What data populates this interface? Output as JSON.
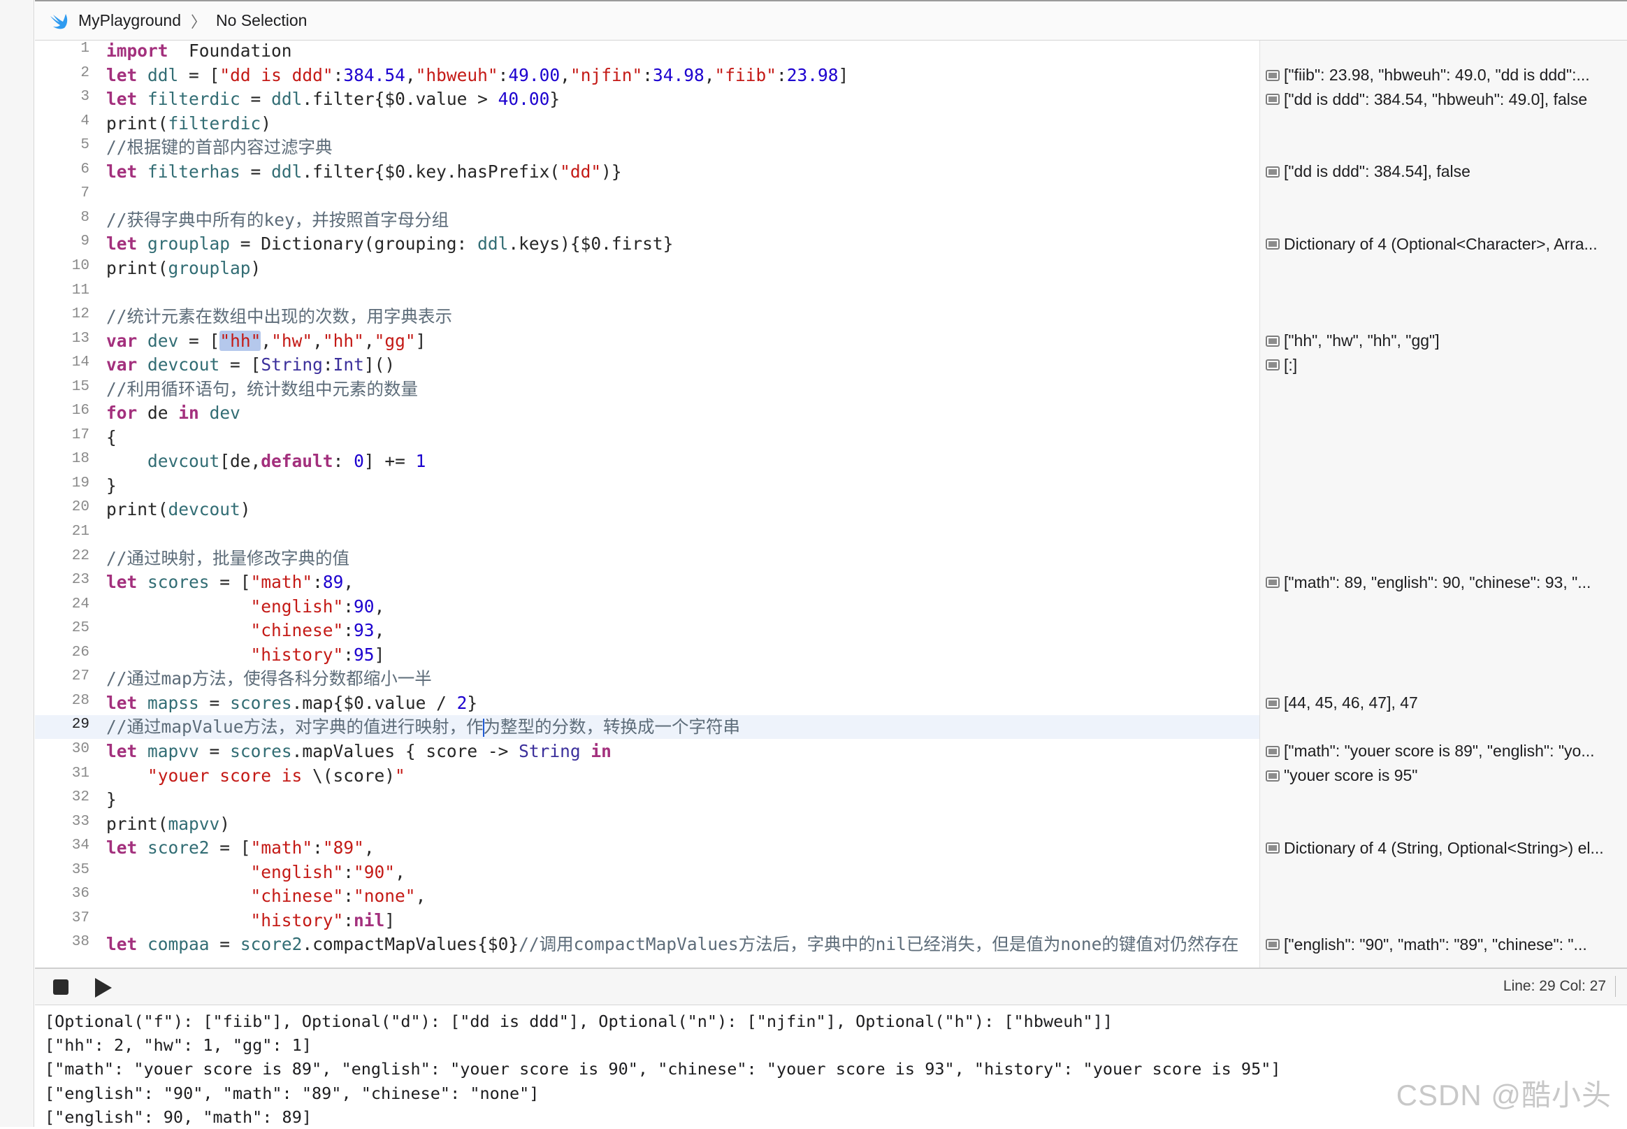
{
  "jumpbar": {
    "project": "MyPlayground",
    "selection": "No Selection"
  },
  "editor": {
    "current_line": 29,
    "lines": [
      {
        "n": "1",
        "tokens": [
          [
            "kw",
            "import"
          ],
          [
            "",
            "  Foundation"
          ]
        ]
      },
      {
        "n": "2",
        "tokens": [
          [
            "kw",
            "let"
          ],
          [
            "",
            " "
          ],
          [
            "id",
            "ddl"
          ],
          [
            "",
            " = ["
          ],
          [
            "str",
            "\"dd is ddd\""
          ],
          [
            "",
            ":"
          ],
          [
            "num",
            "384.54"
          ],
          [
            "",
            ","
          ],
          [
            "str",
            "\"hbweuh\""
          ],
          [
            "",
            ":"
          ],
          [
            "num",
            "49.00"
          ],
          [
            "",
            ","
          ],
          [
            "str",
            "\"njfin\""
          ],
          [
            "",
            ":"
          ],
          [
            "num",
            "34.98"
          ],
          [
            "",
            ","
          ],
          [
            "str",
            "\"fiib\""
          ],
          [
            "",
            ":"
          ],
          [
            "num",
            "23.98"
          ],
          [
            "",
            "]"
          ]
        ]
      },
      {
        "n": "3",
        "tokens": [
          [
            "kw",
            "let"
          ],
          [
            "",
            " "
          ],
          [
            "id",
            "filterdic"
          ],
          [
            "",
            " = "
          ],
          [
            "id",
            "ddl"
          ],
          [
            "",
            ".filter{$0.value > "
          ],
          [
            "num",
            "40.00"
          ],
          [
            "",
            "}"
          ]
        ]
      },
      {
        "n": "4",
        "tokens": [
          [
            "",
            "print("
          ],
          [
            "id",
            "filterdic"
          ],
          [
            "",
            ")"
          ]
        ]
      },
      {
        "n": "5",
        "tokens": [
          [
            "cm",
            "//根据键的首部内容过滤字典"
          ]
        ]
      },
      {
        "n": "6",
        "tokens": [
          [
            "kw",
            "let"
          ],
          [
            "",
            " "
          ],
          [
            "id",
            "filterhas"
          ],
          [
            "",
            " = "
          ],
          [
            "id",
            "ddl"
          ],
          [
            "",
            ".filter{$0.key.hasPrefix("
          ],
          [
            "str",
            "\"dd\""
          ],
          [
            "",
            ")}"
          ]
        ]
      },
      {
        "n": "7",
        "tokens": []
      },
      {
        "n": "8",
        "tokens": [
          [
            "cm",
            "//获得字典中所有的key，并按照首字母分组"
          ]
        ]
      },
      {
        "n": "9",
        "tokens": [
          [
            "kw",
            "let"
          ],
          [
            "",
            " "
          ],
          [
            "id",
            "grouplap"
          ],
          [
            "",
            " = Dictionary(grouping: "
          ],
          [
            "id",
            "ddl"
          ],
          [
            "",
            ".keys){$0.first}"
          ]
        ]
      },
      {
        "n": "10",
        "tokens": [
          [
            "",
            "print("
          ],
          [
            "id",
            "grouplap"
          ],
          [
            "",
            ")"
          ]
        ]
      },
      {
        "n": "11",
        "tokens": []
      },
      {
        "n": "12",
        "tokens": [
          [
            "cm",
            "//统计元素在数组中出现的次数，用字典表示"
          ]
        ]
      },
      {
        "n": "13",
        "tokens": [
          [
            "kw",
            "var"
          ],
          [
            "",
            " "
          ],
          [
            "id",
            "dev"
          ],
          [
            "",
            " = ["
          ],
          [
            "hlstr",
            "\"hh\""
          ],
          [
            "",
            ","
          ],
          [
            "str",
            "\"hw\""
          ],
          [
            "",
            ","
          ],
          [
            "str",
            "\"hh\""
          ],
          [
            "",
            ","
          ],
          [
            "str",
            "\"gg\""
          ],
          [
            "",
            "]"
          ]
        ]
      },
      {
        "n": "14",
        "tokens": [
          [
            "kw",
            "var"
          ],
          [
            "",
            " "
          ],
          [
            "id",
            "devcout"
          ],
          [
            "",
            " = ["
          ],
          [
            "ty",
            "String"
          ],
          [
            "",
            ":"
          ],
          [
            "ty",
            "Int"
          ],
          [
            "",
            "]()"
          ]
        ]
      },
      {
        "n": "15",
        "tokens": [
          [
            "cm",
            "//利用循环语句，统计数组中元素的数量"
          ]
        ]
      },
      {
        "n": "16",
        "tokens": [
          [
            "kw",
            "for"
          ],
          [
            "",
            " de "
          ],
          [
            "kw",
            "in"
          ],
          [
            "",
            " "
          ],
          [
            "id",
            "dev"
          ]
        ]
      },
      {
        "n": "17",
        "tokens": [
          [
            "",
            "{"
          ]
        ]
      },
      {
        "n": "18",
        "tokens": [
          [
            "",
            "    "
          ],
          [
            "id",
            "devcout"
          ],
          [
            "",
            "[de,"
          ],
          [
            "kw",
            "default"
          ],
          [
            "",
            ": "
          ],
          [
            "num",
            "0"
          ],
          [
            "",
            "] += "
          ],
          [
            "num",
            "1"
          ]
        ]
      },
      {
        "n": "19",
        "tokens": [
          [
            "",
            "}"
          ]
        ]
      },
      {
        "n": "20",
        "tokens": [
          [
            "",
            "print("
          ],
          [
            "id",
            "devcout"
          ],
          [
            "",
            ")"
          ]
        ]
      },
      {
        "n": "21",
        "tokens": []
      },
      {
        "n": "22",
        "tokens": [
          [
            "cm",
            "//通过映射，批量修改字典的值"
          ]
        ]
      },
      {
        "n": "23",
        "tokens": [
          [
            "kw",
            "let"
          ],
          [
            "",
            " "
          ],
          [
            "id",
            "scores"
          ],
          [
            "",
            " = ["
          ],
          [
            "str",
            "\"math\""
          ],
          [
            "",
            ":"
          ],
          [
            "num",
            "89"
          ],
          [
            "",
            ","
          ]
        ]
      },
      {
        "n": "24",
        "tokens": [
          [
            "",
            "              "
          ],
          [
            "str",
            "\"english\""
          ],
          [
            "",
            ":"
          ],
          [
            "num",
            "90"
          ],
          [
            "",
            ","
          ]
        ]
      },
      {
        "n": "25",
        "tokens": [
          [
            "",
            "              "
          ],
          [
            "str",
            "\"chinese\""
          ],
          [
            "",
            ":"
          ],
          [
            "num",
            "93"
          ],
          [
            "",
            ","
          ]
        ]
      },
      {
        "n": "26",
        "tokens": [
          [
            "",
            "              "
          ],
          [
            "str",
            "\"history\""
          ],
          [
            "",
            ":"
          ],
          [
            "num",
            "95"
          ],
          [
            "",
            "]"
          ]
        ]
      },
      {
        "n": "27",
        "tokens": [
          [
            "cm",
            "//通过map方法，使得各科分数都缩小一半"
          ]
        ]
      },
      {
        "n": "28",
        "tokens": [
          [
            "kw",
            "let"
          ],
          [
            "",
            " "
          ],
          [
            "id",
            "mapss"
          ],
          [
            "",
            " = "
          ],
          [
            "id",
            "scores"
          ],
          [
            "",
            ".map{$0.value / "
          ],
          [
            "num",
            "2"
          ],
          [
            "",
            "}"
          ]
        ]
      },
      {
        "n": "29",
        "tokens": [
          [
            "cm",
            "//通过mapValue方法，对字典的值进行映射，作"
          ],
          [
            "caret",
            ""
          ],
          [
            "cm",
            "为整型的分数，转换成一个字符串"
          ]
        ]
      },
      {
        "n": "30",
        "tokens": [
          [
            "kw",
            "let"
          ],
          [
            "",
            " "
          ],
          [
            "id",
            "mapvv"
          ],
          [
            "",
            " = "
          ],
          [
            "id",
            "scores"
          ],
          [
            "",
            ".mapValues { score -> "
          ],
          [
            "ty",
            "String"
          ],
          [
            "",
            " "
          ],
          [
            "kw",
            "in"
          ]
        ]
      },
      {
        "n": "31",
        "tokens": [
          [
            "",
            "    "
          ],
          [
            "str",
            "\"youer score is "
          ],
          [
            "",
            "\\(score)"
          ],
          [
            "str",
            "\""
          ]
        ]
      },
      {
        "n": "32",
        "tokens": [
          [
            "",
            "}"
          ]
        ]
      },
      {
        "n": "33",
        "tokens": [
          [
            "",
            "print("
          ],
          [
            "id",
            "mapvv"
          ],
          [
            "",
            ")"
          ]
        ]
      },
      {
        "n": "34",
        "tokens": [
          [
            "kw",
            "let"
          ],
          [
            "",
            " "
          ],
          [
            "id",
            "score2"
          ],
          [
            "",
            " = ["
          ],
          [
            "str",
            "\"math\""
          ],
          [
            "",
            ":"
          ],
          [
            "str",
            "\"89\""
          ],
          [
            "",
            ","
          ]
        ]
      },
      {
        "n": "35",
        "tokens": [
          [
            "",
            "              "
          ],
          [
            "str",
            "\"english\""
          ],
          [
            "",
            ":"
          ],
          [
            "str",
            "\"90\""
          ],
          [
            "",
            ","
          ]
        ]
      },
      {
        "n": "36",
        "tokens": [
          [
            "",
            "              "
          ],
          [
            "str",
            "\"chinese\""
          ],
          [
            "",
            ":"
          ],
          [
            "str",
            "\"none\""
          ],
          [
            "",
            ","
          ]
        ]
      },
      {
        "n": "37",
        "tokens": [
          [
            "",
            "              "
          ],
          [
            "str",
            "\"history\""
          ],
          [
            "",
            ":"
          ],
          [
            "kw",
            "nil"
          ],
          [
            "",
            "]"
          ]
        ]
      },
      {
        "n": "38",
        "tokens": [
          [
            "kw",
            "let"
          ],
          [
            "",
            " "
          ],
          [
            "id",
            "compaa"
          ],
          [
            "",
            " = "
          ],
          [
            "id",
            "score2"
          ],
          [
            "",
            ".compactMapValues{$0}"
          ],
          [
            "cm",
            "//调用compactMapValues方法后，字典中的nil已经消失，但是值为none的键值对仍然存在"
          ]
        ]
      }
    ]
  },
  "results": [
    {
      "line": 2,
      "text": "[\"fiib\": 23.98, \"hbweuh\": 49.0, \"dd is ddd\":..."
    },
    {
      "line": 3,
      "text": "[\"dd is ddd\": 384.54, \"hbweuh\": 49.0], false"
    },
    {
      "line": 6,
      "text": "[\"dd is ddd\": 384.54], false"
    },
    {
      "line": 9,
      "text": "Dictionary of 4 (Optional<Character>, Arra..."
    },
    {
      "line": 13,
      "text": "[\"hh\", \"hw\", \"hh\", \"gg\"]"
    },
    {
      "line": 14,
      "text": "[:]"
    },
    {
      "line": 23,
      "text": "[\"math\": 89, \"english\": 90, \"chinese\": 93, \"..."
    },
    {
      "line": 28,
      "text": "[44, 45, 46, 47], 47"
    },
    {
      "line": 30,
      "text": "[\"math\": \"youer score is 89\", \"english\": \"yo..."
    },
    {
      "line": 31,
      "text": "\"youer score is 95\""
    },
    {
      "line": 34,
      "text": "Dictionary of 4 (String, Optional<String>) el..."
    },
    {
      "line": 38,
      "text": "[\"english\": \"90\", \"math\": \"89\", \"chinese\": \"..."
    }
  ],
  "debugbar": {
    "position": "Line: 29  Col: 27"
  },
  "console": {
    "lines": [
      "[Optional(\"f\"): [\"fiib\"], Optional(\"d\"): [\"dd is ddd\"], Optional(\"n\"): [\"njfin\"], Optional(\"h\"): [\"hbweuh\"]]",
      "[\"hh\": 2, \"hw\": 1, \"gg\": 1]",
      "[\"math\": \"youer score is 89\", \"english\": \"youer score is 90\", \"chinese\": \"youer score is 93\", \"history\": \"youer score is 95\"]",
      "[\"english\": \"90\", \"math\": \"89\", \"chinese\": \"none\"]",
      "[\"english\": 90, \"math\": 89]"
    ]
  },
  "watermark": "CSDN @酷小头",
  "colors": {
    "keyword": "#a3307d",
    "string": "#c41a16",
    "number": "#1c00cf",
    "comment": "#5d6c79",
    "type": "#3b2f9b",
    "identifier": "#326d74"
  }
}
